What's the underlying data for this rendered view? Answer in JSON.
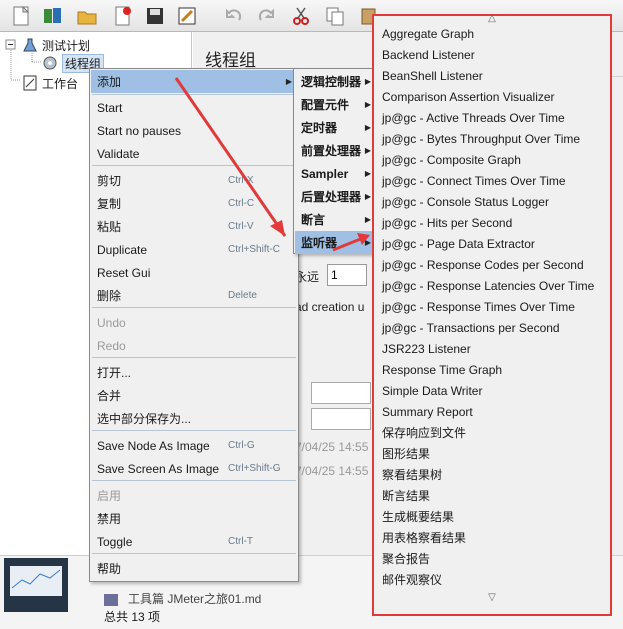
{
  "tree": {
    "plan": "测试计划",
    "thread_group": "线程组",
    "workbench": "工作台"
  },
  "panel": {
    "title": "线程组",
    "loop_forever": "永远",
    "loop_count": "1",
    "delay_text": "ad creation u",
    "time1": "7/04/25 14:55",
    "time2": "7/04/25 14:55"
  },
  "bottom": {
    "file_label": "工具篇  JMeter之旅01.md",
    "total": "总共 13 项"
  },
  "context_menu": {
    "items": [
      {
        "label": "添加",
        "shortcut": "",
        "submenu": true,
        "active": true
      },
      {
        "label": "Start",
        "shortcut": ""
      },
      {
        "label": "Start no pauses",
        "shortcut": ""
      },
      {
        "label": "Validate",
        "shortcut": ""
      },
      {
        "label": "剪切",
        "shortcut": "Ctrl-X"
      },
      {
        "label": "复制",
        "shortcut": "Ctrl-C"
      },
      {
        "label": "粘贴",
        "shortcut": "Ctrl-V"
      },
      {
        "label": "Duplicate",
        "shortcut": "Ctrl+Shift-C"
      },
      {
        "label": "Reset Gui",
        "shortcut": ""
      },
      {
        "label": "删除",
        "shortcut": "Delete"
      },
      {
        "label": "Undo",
        "shortcut": "",
        "disabled": true
      },
      {
        "label": "Redo",
        "shortcut": "",
        "disabled": true
      },
      {
        "label": "打开...",
        "shortcut": ""
      },
      {
        "label": "合并",
        "shortcut": ""
      },
      {
        "label": "选中部分保存为...",
        "shortcut": ""
      },
      {
        "label": "Save Node As Image",
        "shortcut": "Ctrl-G"
      },
      {
        "label": "Save Screen As Image",
        "shortcut": "Ctrl+Shift-G"
      },
      {
        "label": "启用",
        "shortcut": "",
        "disabled": true
      },
      {
        "label": "禁用",
        "shortcut": ""
      },
      {
        "label": "Toggle",
        "shortcut": "Ctrl-T"
      },
      {
        "label": "帮助",
        "shortcut": ""
      }
    ]
  },
  "add_submenu": {
    "items": [
      {
        "label": "逻辑控制器"
      },
      {
        "label": "配置元件"
      },
      {
        "label": "定时器"
      },
      {
        "label": "前置处理器"
      },
      {
        "label": "Sampler"
      },
      {
        "label": "后置处理器"
      },
      {
        "label": "断言"
      },
      {
        "label": "监听器",
        "active": true
      }
    ]
  },
  "listener_menu": {
    "items": [
      "Aggregate Graph",
      "Backend Listener",
      "BeanShell Listener",
      "Comparison Assertion Visualizer",
      "jp@gc - Active Threads Over Time",
      "jp@gc - Bytes Throughput Over Time",
      "jp@gc - Composite Graph",
      "jp@gc - Connect Times Over Time",
      "jp@gc - Console Status Logger",
      "jp@gc - Hits per Second",
      "jp@gc - Page Data Extractor",
      "jp@gc - Response Codes per Second",
      "jp@gc - Response Latencies Over Time",
      "jp@gc - Response Times Over Time",
      "jp@gc - Transactions per Second",
      "JSR223 Listener",
      "Response Time Graph",
      "Simple Data Writer",
      "Summary Report",
      "保存响应到文件",
      "图形结果",
      "察看结果树",
      "断言结果",
      "生成概要结果",
      "用表格察看结果",
      "聚合报告",
      "邮件观察仪"
    ]
  },
  "colors": {
    "highlight_border": "#e03a3a",
    "selection": "#9fc0e4"
  }
}
